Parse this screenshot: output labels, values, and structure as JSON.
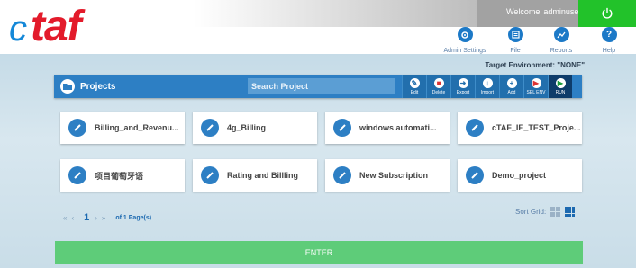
{
  "header": {
    "welcome": "Welcome",
    "username": "adminuser",
    "logo_c": "c",
    "logo_taf": "taf",
    "nav": [
      {
        "label": "Admin Settings",
        "icon": "gear-icon"
      },
      {
        "label": "File",
        "icon": "file-icon"
      },
      {
        "label": "Reports",
        "icon": "chart-icon"
      },
      {
        "label": "Help",
        "icon": "help-icon"
      }
    ]
  },
  "target_env": "Target Environment: \"NONE\"",
  "toolbar": {
    "title": "Projects",
    "search_placeholder": "Search Project",
    "buttons": [
      {
        "label": "Edit"
      },
      {
        "label": "Delete"
      },
      {
        "label": "Export"
      },
      {
        "label": "Import"
      },
      {
        "label": "Add"
      },
      {
        "label": "SEL ENV"
      },
      {
        "label": "RUN"
      }
    ]
  },
  "projects": [
    "Billing_and_Revenu...",
    "4g_Billing",
    "windows automati...",
    "cTAF_IE_TEST_Proje...",
    "项目葡萄牙语",
    "Rating and Billling",
    "New Subscription",
    "Demo_project"
  ],
  "pager": {
    "first": "«",
    "prev": "‹",
    "page": "1",
    "next": "›",
    "last": "»",
    "of": "of 1 Page(s)"
  },
  "sort_grid_label": "Sort Grid:",
  "enter_label": "ENTER",
  "colors": {
    "accent": "#2d7fc4",
    "logo_red": "#e31b2b",
    "power_green": "#22c22a",
    "enter_green": "#5ecc79"
  }
}
